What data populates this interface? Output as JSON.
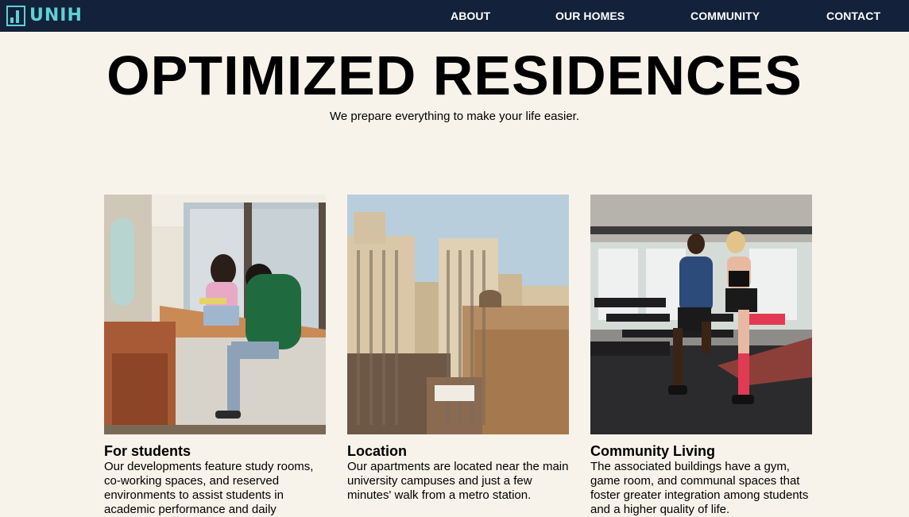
{
  "brand": {
    "name": "UNIH"
  },
  "nav": {
    "items": [
      {
        "label": "ABOUT"
      },
      {
        "label": "OUR HOMES"
      },
      {
        "label": "COMMUNITY"
      },
      {
        "label": "CONTACT"
      }
    ]
  },
  "hero": {
    "title": "OPTIMIZED RESIDENCES",
    "subtitle": "We prepare everything to make your life easier."
  },
  "cards": [
    {
      "title": "For students",
      "text": "Our developments feature study rooms, co-working spaces, and reserved environments to assist students in academic performance and daily",
      "image": "students-studying-photo"
    },
    {
      "title": "Location",
      "text": "Our apartments are located near the main university campuses and just a few minutes' walk from a metro station.",
      "image": "city-buildings-photo"
    },
    {
      "title": "Community Living",
      "text": "The associated buildings have a gym, game room, and communal spaces that foster greater integration among students and a higher quality of life.",
      "image": "gym-stretching-photo"
    }
  ],
  "colors": {
    "nav_bg": "#13223a",
    "accent": "#5fd0d6",
    "page_bg": "#f8f3ea"
  }
}
